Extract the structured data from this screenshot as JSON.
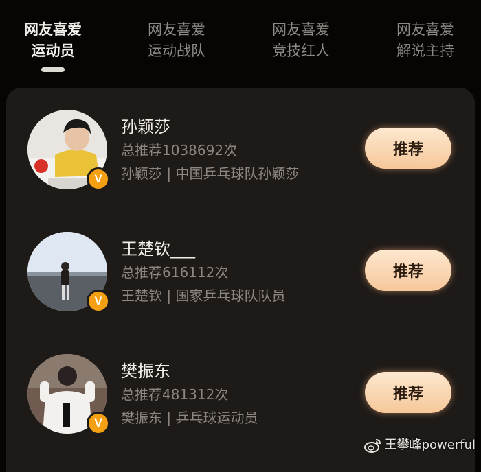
{
  "tabs": [
    {
      "line1": "网友喜爱",
      "line2": "运动员",
      "active": true
    },
    {
      "line1": "网友喜爱",
      "line2": "运动战队",
      "active": false
    },
    {
      "line1": "网友喜爱",
      "line2": "竞技红人",
      "active": false
    },
    {
      "line1": "网友喜爱",
      "line2": "解说主持",
      "active": false
    }
  ],
  "entries": [
    {
      "name": "孙颖莎",
      "count": "总推荐1038692次",
      "desc": "孙颖莎 | 中国乒乓球队孙颖莎",
      "button": "推荐",
      "badge": "V"
    },
    {
      "name": "王楚钦___",
      "count": "总推荐616112次",
      "desc": "王楚钦 | 国家乒乓球队队员",
      "button": "推荐",
      "badge": "V"
    },
    {
      "name": "樊振东",
      "count": "总推荐481312次",
      "desc": "樊振东 | 乒乓球运动员",
      "button": "推荐",
      "badge": "V"
    }
  ],
  "watermark": "王攀峰powerful",
  "colors": {
    "accent": "#f6c79a",
    "badge": "#f5a012",
    "background": "#060504",
    "panel": "#1d1a18"
  }
}
